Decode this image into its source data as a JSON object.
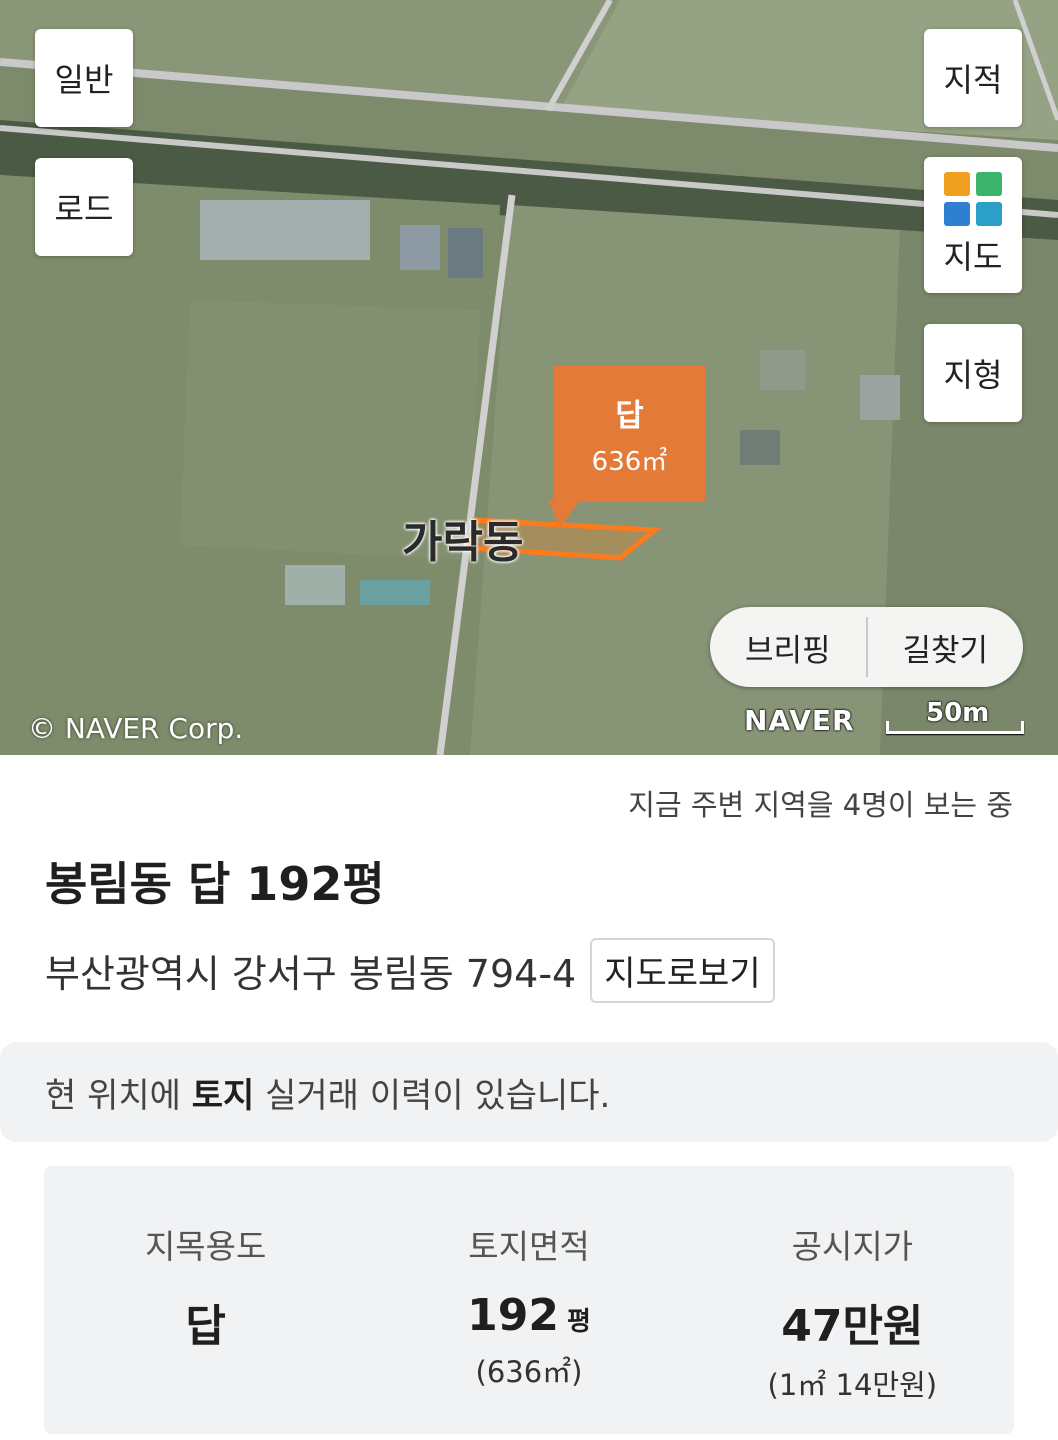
{
  "map": {
    "buttons": {
      "normal": "일반",
      "road": "로드",
      "cadastral": "지적",
      "map": "지도",
      "terrain": "지형"
    },
    "parcel_marker": {
      "type": "답",
      "area": "636㎡"
    },
    "place_label": "가락동",
    "copyright": "© NAVER Corp.",
    "logo": "NAVER",
    "scale": "50m",
    "briefing": "브리핑",
    "directions": "길찾기"
  },
  "panel": {
    "viewers": "지금 주변 지역을 4명이 보는 중",
    "title": "봉림동 답 192평",
    "address": "부산광역시 강서구 봉림동 794-4",
    "view_on_map": "지도로보기",
    "notice_prefix": "현 위치에 ",
    "notice_bold": "토지",
    "notice_suffix": " 실거래 이력이 있습니다.",
    "info": [
      {
        "label": "지목용도",
        "value": "답",
        "unit": "",
        "sub": ""
      },
      {
        "label": "토지면적",
        "value": "192",
        "unit": "평",
        "sub": "(636㎡)"
      },
      {
        "label": "공시지가",
        "value": "47만원",
        "unit": "",
        "sub": "(1㎡ 14만원)"
      }
    ]
  },
  "colors": {
    "marker": "#e47a38",
    "map_icon_house": "#f0a020",
    "map_icon_green": "#3bb36a",
    "map_icon_blue": "#2e7fd0",
    "map_icon_teal": "#2aa0c8"
  }
}
